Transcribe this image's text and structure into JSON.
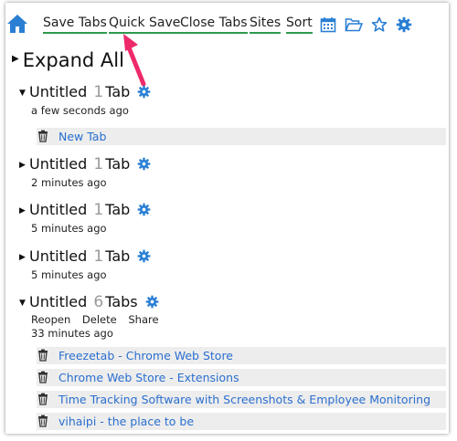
{
  "toolbar": {
    "save_tabs": "Save Tabs",
    "quick_save": "Quick Save",
    "close_tabs": "Close Tabs",
    "sites": "Sites",
    "sort": "Sort"
  },
  "expand_all": "Expand All",
  "groups": [
    {
      "title": "Untitled",
      "count": "1",
      "unit": "Tab",
      "time": "a few seconds ago",
      "expanded": true,
      "tabs": [
        "New Tab"
      ]
    },
    {
      "title": "Untitled",
      "count": "1",
      "unit": "Tab",
      "time": "2 minutes ago",
      "expanded": false
    },
    {
      "title": "Untitled",
      "count": "1",
      "unit": "Tab",
      "time": "5 minutes ago",
      "expanded": false
    },
    {
      "title": "Untitled",
      "count": "1",
      "unit": "Tab",
      "time": "5 minutes ago",
      "expanded": false
    },
    {
      "title": "Untitled",
      "count": "6",
      "unit": "Tabs",
      "time": "33 minutes ago",
      "expanded": true,
      "actions": {
        "reopen": "Reopen",
        "delete": "Delete",
        "share": "Share"
      },
      "tabs": [
        "Freezetab - Chrome Web Store",
        "Chrome Web Store - Extensions",
        "Time Tracking Software with Screenshots & Employee Monitoring",
        "vihaipi - the place to be"
      ]
    }
  ],
  "colors": {
    "accent_blue": "#2a7fd4",
    "underline_green": "#2e9a4d",
    "link_blue": "#2a6fcf",
    "annotation_pink": "#ee2a6a"
  }
}
